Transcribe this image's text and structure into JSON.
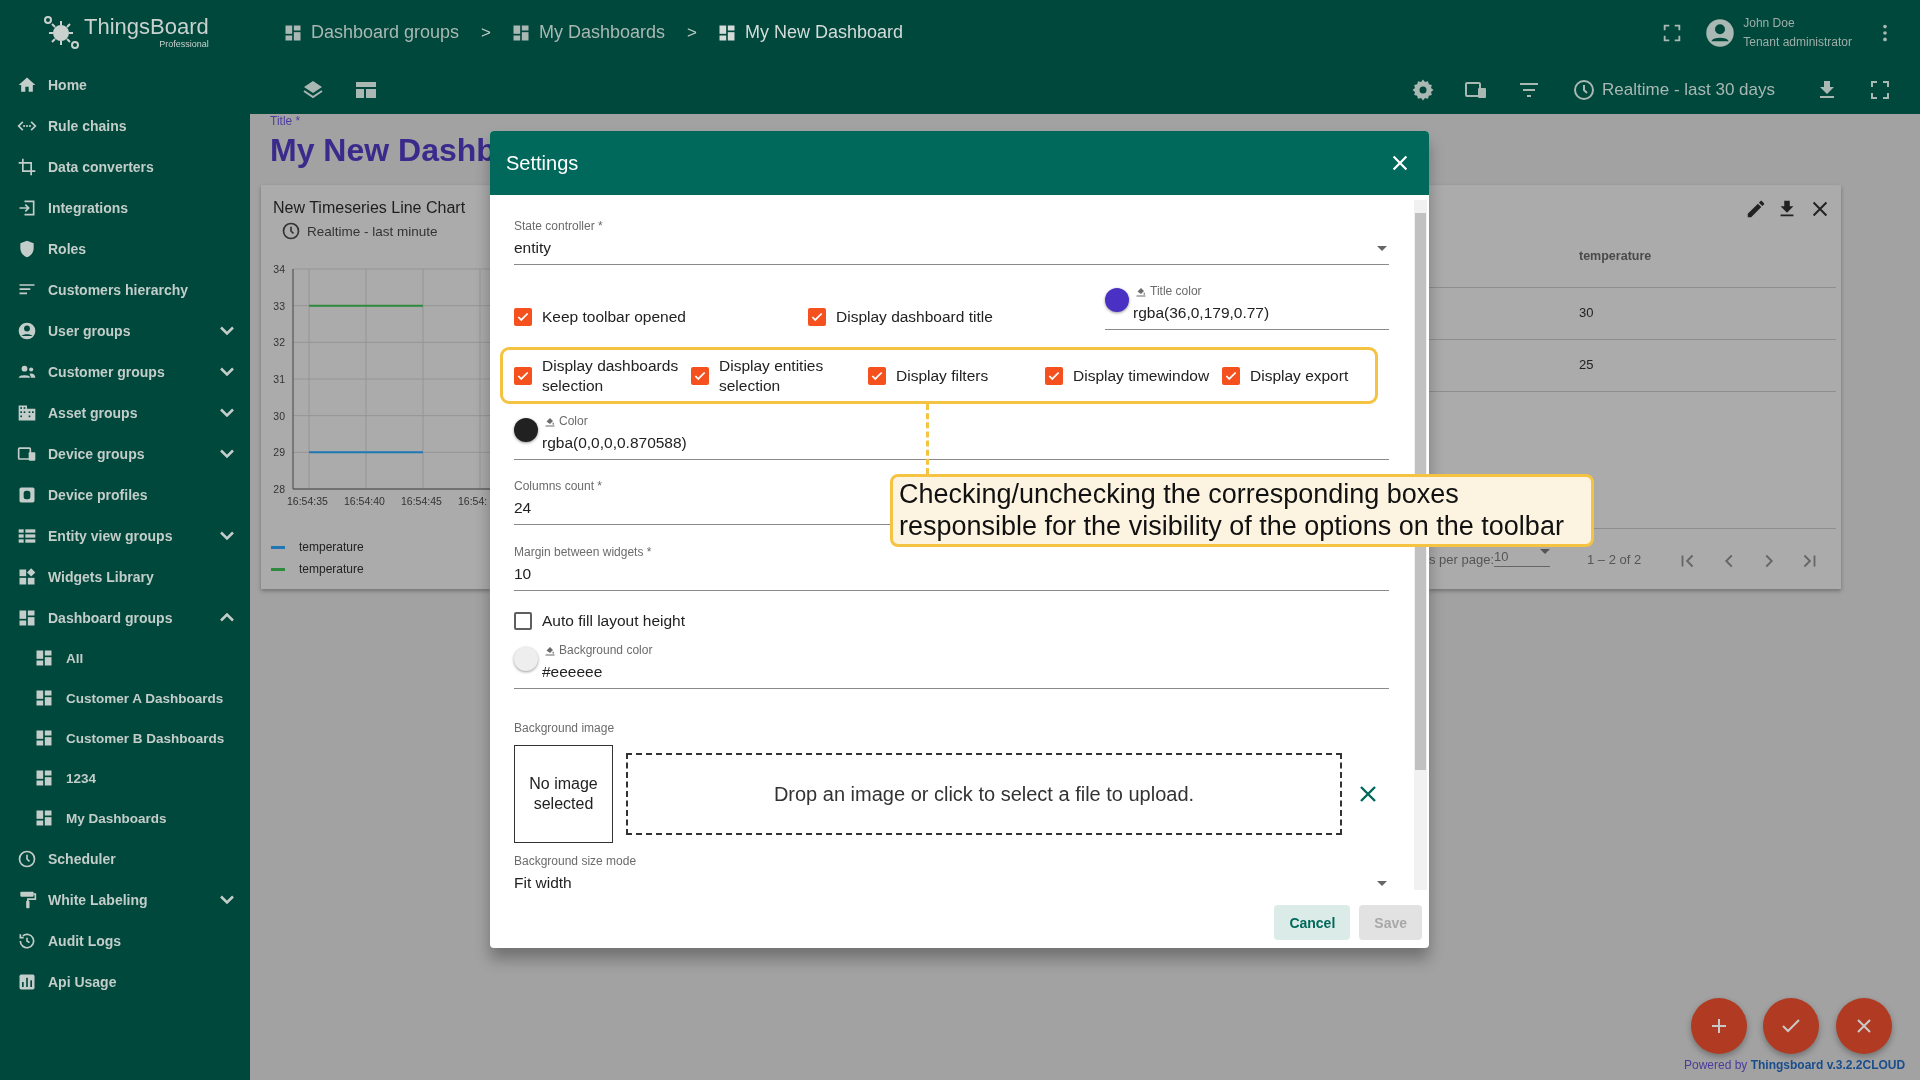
{
  "sidebar": {
    "logo": {
      "name": "ThingsBoard",
      "edition": "Professional"
    },
    "items": [
      {
        "label": "Home"
      },
      {
        "label": "Rule chains"
      },
      {
        "label": "Data converters"
      },
      {
        "label": "Integrations"
      },
      {
        "label": "Roles"
      },
      {
        "label": "Customers hierarchy"
      },
      {
        "label": "User groups",
        "expanded": false
      },
      {
        "label": "Customer groups",
        "expanded": false
      },
      {
        "label": "Asset groups",
        "expanded": false
      },
      {
        "label": "Device groups",
        "expanded": false
      },
      {
        "label": "Device profiles"
      },
      {
        "label": "Entity view groups",
        "expanded": false
      },
      {
        "label": "Widgets Library"
      },
      {
        "label": "Dashboard groups",
        "expanded": true,
        "children": [
          {
            "label": "All"
          },
          {
            "label": "Customer A Dashboards"
          },
          {
            "label": "Customer B Dashboards"
          },
          {
            "label": "1234"
          },
          {
            "label": "My Dashboards"
          }
        ]
      },
      {
        "label": "Scheduler"
      },
      {
        "label": "White Labeling",
        "expanded": false
      },
      {
        "label": "Audit Logs"
      },
      {
        "label": "Api Usage"
      }
    ]
  },
  "header": {
    "breadcrumbs": [
      {
        "label": "Dashboard groups",
        "selected": false
      },
      {
        "separator": ">",
        "label": "My Dashboards",
        "selected": false
      },
      {
        "separator": ">",
        "label": "My New Dashboard",
        "selected": true
      }
    ],
    "user": {
      "name": "John Doe",
      "role": "Tenant administrator"
    }
  },
  "toolbar": {
    "timewindow": "Realtime - last 30 days"
  },
  "dashboard": {
    "title_label": "Title *",
    "title": "My New Dashb",
    "widgets": [
      {
        "kind": "chart",
        "title": "New Timeseries Line Chart",
        "timewindow": "Realtime - last minute",
        "chart_data": {
          "type": "line",
          "ylim": [
            28,
            34
          ],
          "yticks": [
            28,
            29,
            30,
            31,
            32,
            33,
            34
          ],
          "categories": [
            "16:54:35",
            "16:54:40",
            "16:54:45"
          ],
          "grid": true,
          "series": [
            {
              "name": "temperature",
              "color": "#1f77b4",
              "values": [
                29,
                29,
                29
              ]
            },
            {
              "name": "temperature",
              "color": "#2e8b3e",
              "values": [
                33,
                33,
                33
              ]
            }
          ]
        },
        "clipped_axis_label": "16:54:"
      },
      {
        "kind": "table",
        "columns": [
          "temperature"
        ],
        "rows": [
          [
            "30"
          ],
          [
            "25"
          ]
        ],
        "paginator": {
          "page_size_label": "s per page:",
          "page_size": "10",
          "range": "1 – 2 of 2"
        }
      }
    ]
  },
  "settings_dialog": {
    "title": "Settings",
    "state_controller": {
      "label": "State controller *",
      "value": "entity"
    },
    "toolbar_options": [
      {
        "label": "Keep toolbar opened",
        "checked": true
      },
      {
        "label": "Display dashboard title",
        "checked": true
      }
    ],
    "title_color": {
      "label": "Title color",
      "value": "rgba(36,0,179,0.77)",
      "color": "#4a31c4"
    },
    "visibility_options": [
      {
        "label": "Display dashboards selection",
        "checked": true
      },
      {
        "label": "Display entities selection",
        "checked": true
      },
      {
        "label": "Display filters",
        "checked": true
      },
      {
        "label": "Display timewindow",
        "checked": true
      },
      {
        "label": "Display export",
        "checked": true
      }
    ],
    "color": {
      "label": "Color",
      "value": "rgba(0,0,0,0.870588)",
      "color": "#212121"
    },
    "columns_count": {
      "label": "Columns count *",
      "value": "24"
    },
    "margin": {
      "label": "Margin between widgets *",
      "value": "10"
    },
    "auto_fill": {
      "label": "Auto fill layout height",
      "checked": false
    },
    "background_color": {
      "label": "Background color",
      "value": "#eeeeee",
      "color": "#eeeeee"
    },
    "background_image": {
      "label": "Background image",
      "preview": "No image selected",
      "drop_zone": "Drop an image or click to select a file to upload."
    },
    "background_size_mode": {
      "label": "Background size mode",
      "value": "Fit width"
    },
    "buttons": [
      {
        "label": "Cancel",
        "disabled": false
      },
      {
        "label": "Save",
        "disabled": true
      }
    ]
  },
  "callout": {
    "text": "Checking/unchecking the corresponding boxes responsible for the visibility of the options on the toolbar"
  },
  "footer": {
    "text": "Powered by **Thingsboard v.3.2.2CLOUD**"
  }
}
